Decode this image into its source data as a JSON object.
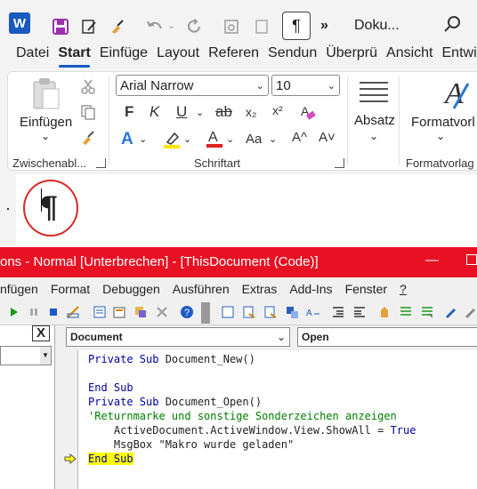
{
  "word": {
    "doc_title": "Doku...",
    "logo_letter": "W",
    "tabs": [
      "Datei",
      "Start",
      "Einfüge",
      "Layout",
      "Referen",
      "Sendun",
      "Überprü",
      "Ansicht",
      "Entwick"
    ],
    "active_tab": "Start",
    "ribbon": {
      "paste_label": "Einfügen",
      "clipboard_group": "Zwischenabl...",
      "font_name": "Arial Narrow",
      "font_size": "10",
      "font_group": "Schriftart",
      "paragraph_label": "Absatz",
      "styles_label": "Formatvorl",
      "styles_group": "Formatvorlag",
      "bold": "F",
      "italic": "K",
      "underline": "U",
      "strike": "ab",
      "subscript": "x₂",
      "superscript": "x²",
      "text_effects": "A",
      "change_case": "Aa",
      "grow_font": "A^",
      "shrink_font": "A˅"
    },
    "pilcrow": "¶"
  },
  "vba": {
    "title": "ons - Normal [Unterbrechen] - [ThisDocument (Code)]",
    "menu": [
      "nfügen",
      "Format",
      "Debuggen",
      "Ausführen",
      "Extras",
      "Add-Ins",
      "Fenster",
      "?"
    ],
    "object_combo": "Document",
    "procedure_combo": "Open",
    "left_close": "X",
    "code": [
      {
        "segments": [
          {
            "t": "Private Sub",
            "c": "kw"
          },
          {
            "t": " Document_New()",
            "c": ""
          }
        ]
      },
      {
        "segments": []
      },
      {
        "segments": [
          {
            "t": "End Sub",
            "c": "kw"
          }
        ]
      },
      {
        "segments": [
          {
            "t": "Private Sub",
            "c": "kw"
          },
          {
            "t": " Document_Open()",
            "c": ""
          }
        ]
      },
      {
        "segments": [
          {
            "t": "'Returnmarke und sonstige Sonderzeichen anzeigen",
            "c": "cm"
          }
        ]
      },
      {
        "segments": [
          {
            "t": "    ActiveDocument.ActiveWindow.View.ShowAll = ",
            "c": ""
          },
          {
            "t": "True",
            "c": "kw"
          }
        ]
      },
      {
        "segments": [
          {
            "t": "    MsgBox \"Makro wurde geladen\"",
            "c": ""
          }
        ]
      },
      {
        "segments": [
          {
            "t": "End Sub",
            "c": "kw hl"
          }
        ]
      }
    ]
  },
  "colors": {
    "word_blue": "#185abd",
    "vba_titlebar": "#e81123",
    "highlight": "#ffff00",
    "circle": "#d62626"
  }
}
